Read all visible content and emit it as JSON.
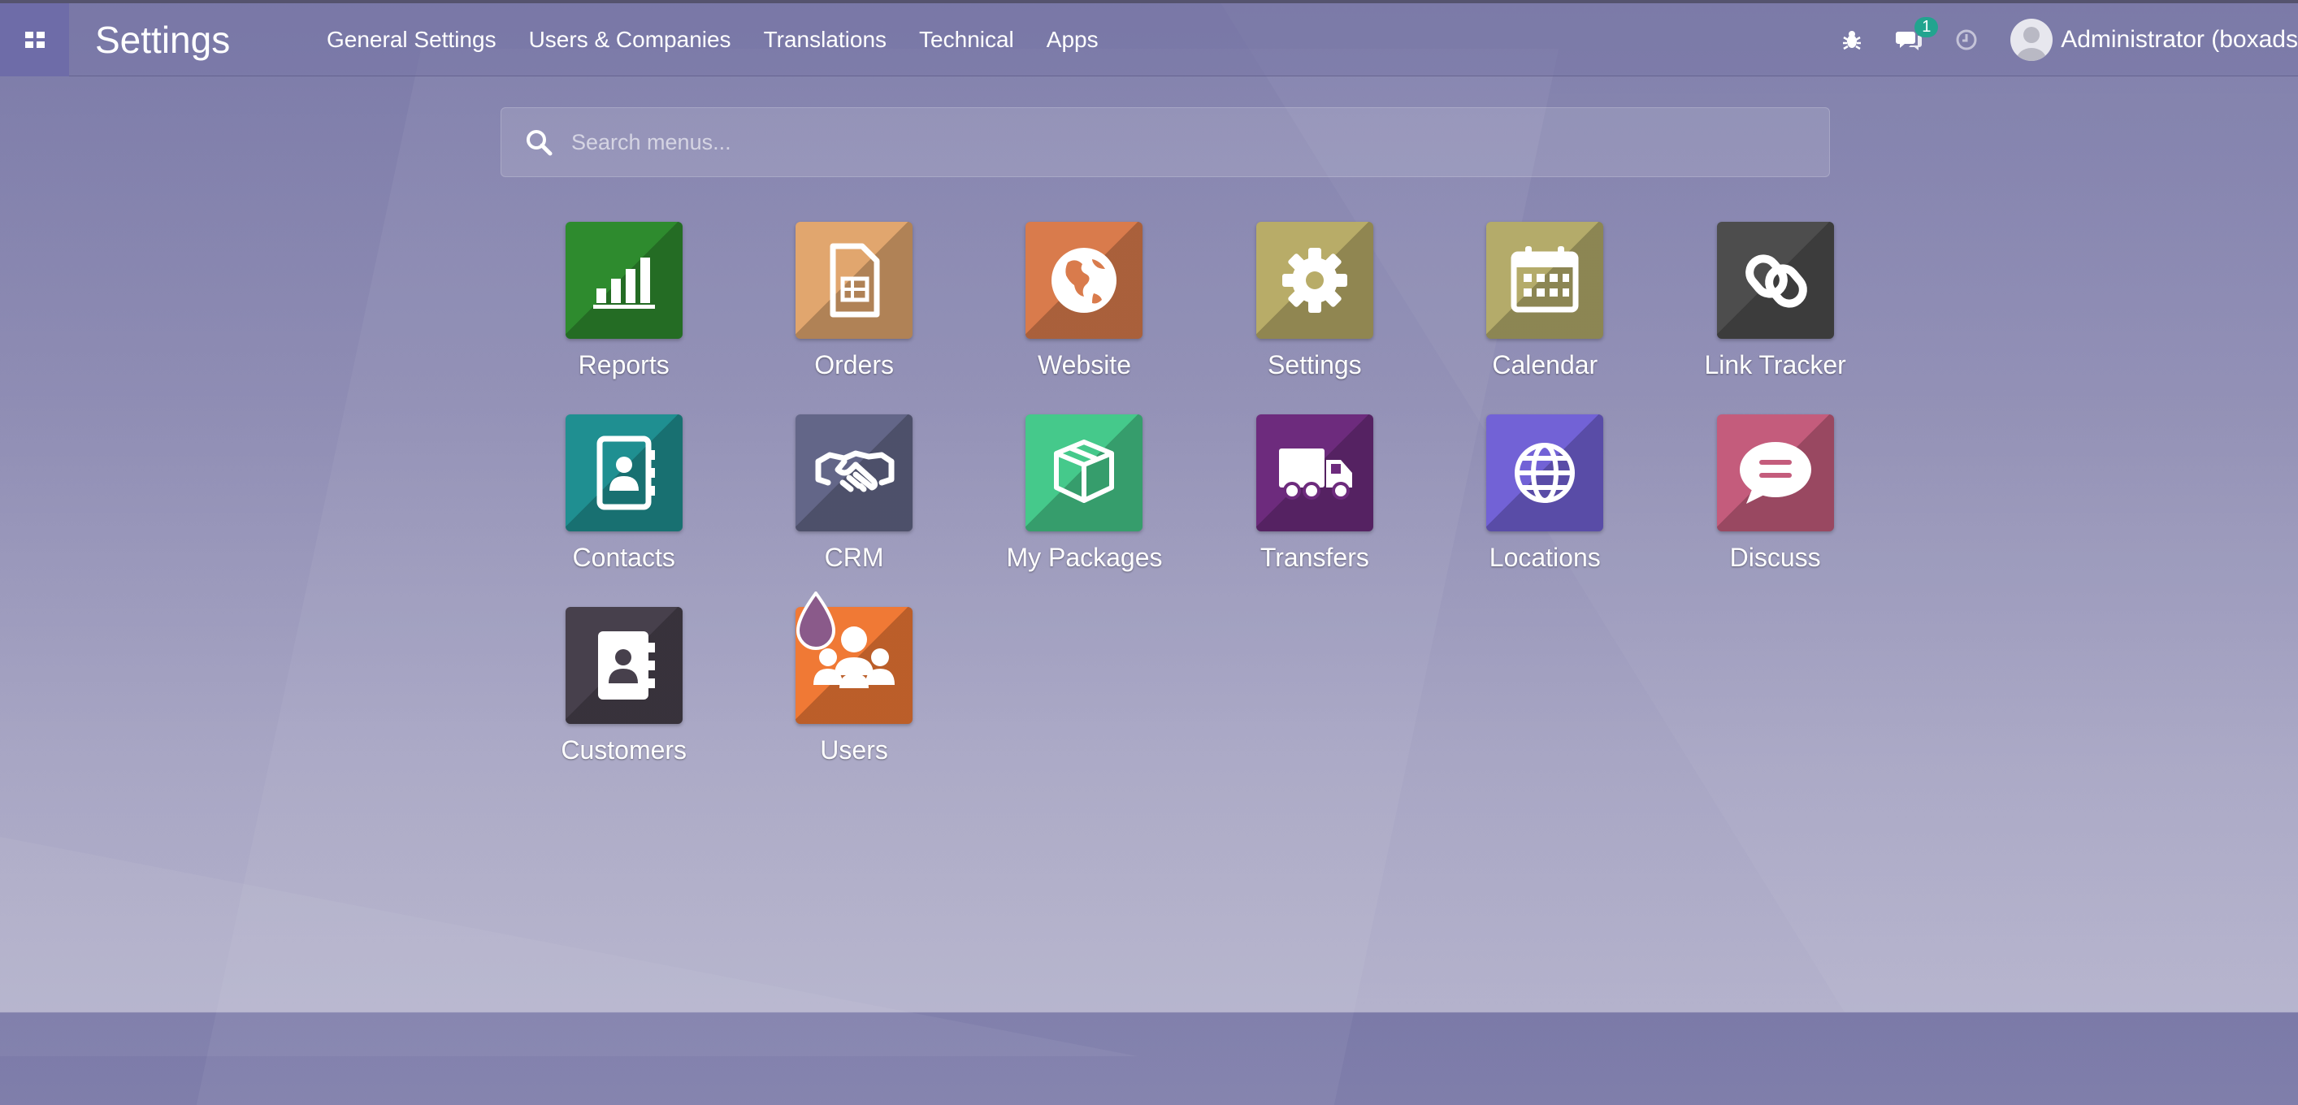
{
  "brand": "Settings",
  "menu": [
    {
      "label": "General Settings"
    },
    {
      "label": "Users & Companies"
    },
    {
      "label": "Translations"
    },
    {
      "label": "Technical"
    },
    {
      "label": "Apps"
    }
  ],
  "systray": {
    "messages_count": "1",
    "user_name": "Administrator (boxads"
  },
  "search": {
    "placeholder": "Search menus..."
  },
  "apps": [
    {
      "label": "Reports",
      "icon": "bar-chart-icon",
      "color": "#2e8b2e"
    },
    {
      "label": "Orders",
      "icon": "document-icon",
      "color": "#e1a66e"
    },
    {
      "label": "Website",
      "icon": "globe-icon",
      "color": "#d97b4c"
    },
    {
      "label": "Settings",
      "icon": "gear-icon",
      "color": "#b8ac68"
    },
    {
      "label": "Calendar",
      "icon": "calendar-icon",
      "color": "#b4ab6a"
    },
    {
      "label": "Link Tracker",
      "icon": "link-icon",
      "color": "#4d4d4d"
    },
    {
      "label": "Contacts",
      "icon": "address-book-icon",
      "color": "#1f8f91"
    },
    {
      "label": "CRM",
      "icon": "handshake-icon",
      "color": "#636688"
    },
    {
      "label": "My Packages",
      "icon": "box-icon",
      "color": "#45c98b"
    },
    {
      "label": "Transfers",
      "icon": "truck-icon",
      "color": "#6d2b7d"
    },
    {
      "label": "Locations",
      "icon": "world-icon",
      "color": "#7262d6"
    },
    {
      "label": "Discuss",
      "icon": "chat-bubble-icon",
      "color": "#c45c7c"
    },
    {
      "label": "Customers",
      "icon": "contact-card-icon",
      "color": "#47404c"
    },
    {
      "label": "Users",
      "icon": "users-icon",
      "color": "#f07935"
    }
  ]
}
